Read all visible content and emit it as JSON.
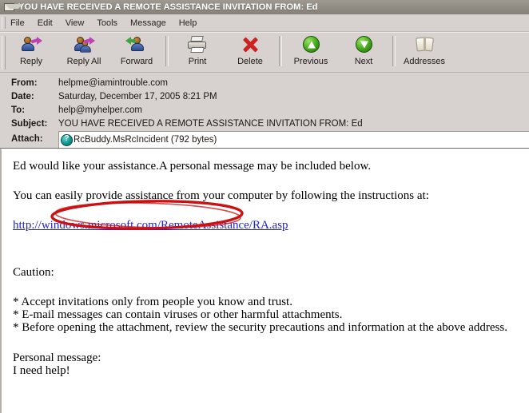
{
  "window": {
    "title": "YOU HAVE RECEIVED A REMOTE ASSISTANCE INVITATION FROM: Ed",
    "icon": "envelope-icon"
  },
  "menubar": {
    "items": [
      {
        "label": "File"
      },
      {
        "label": "Edit"
      },
      {
        "label": "View"
      },
      {
        "label": "Tools"
      },
      {
        "label": "Message"
      },
      {
        "label": "Help"
      }
    ]
  },
  "toolbar": {
    "buttons": [
      {
        "label": "Reply",
        "icon": "reply-icon"
      },
      {
        "label": "Reply All",
        "icon": "reply-all-icon"
      },
      {
        "label": "Forward",
        "icon": "forward-icon"
      },
      {
        "label": "Print",
        "icon": "printer-icon"
      },
      {
        "label": "Delete",
        "icon": "delete-x-icon"
      },
      {
        "label": "Previous",
        "icon": "arrow-up-circle-icon"
      },
      {
        "label": "Next",
        "icon": "arrow-down-circle-icon"
      },
      {
        "label": "Addresses",
        "icon": "address-book-icon"
      }
    ]
  },
  "headers": {
    "from_label": "From:",
    "from_value": "helpme@iamintrouble.com",
    "date_label": "Date:",
    "date_value": "Saturday, December 17, 2005 8:21 PM",
    "to_label": "To:",
    "to_value": "help@myhelper.com",
    "subject_label": "Subject:",
    "subject_value": "YOU HAVE RECEIVED A REMOTE ASSISTANCE INVITATION FROM: Ed",
    "attach_label": "Attach:",
    "attach_value": "RcBuddy.MsRcIncident (792 bytes)",
    "attach_icon": "remote-assistance-icon"
  },
  "annotation": {
    "shape": "ellipse",
    "color": "#cc1111",
    "target": "attachment"
  },
  "message": {
    "line1": "Ed would like your assistance.A personal message may be included below.",
    "line2": "You can easily provide assistance from your computer by following the instructions at:",
    "link": "http://windows.microsoft.com/RemoteAssistance/RA.asp",
    "caution_heading": "Caution:",
    "bullets": [
      "* Accept invitations only from people you know and trust.",
      "* E-mail messages can contain viruses or other harmful attachments.",
      "* Before opening the attachment, review the security precautions and information at the above address."
    ],
    "personal_label": "Personal message:",
    "personal_text": "I need help!"
  },
  "colors": {
    "titlebar": "#8f8b83",
    "chrome": "#d7d1cf",
    "annotation_red": "#cc1111",
    "link_blue": "#2222cc",
    "attach_icon_teal": "#12968f"
  }
}
